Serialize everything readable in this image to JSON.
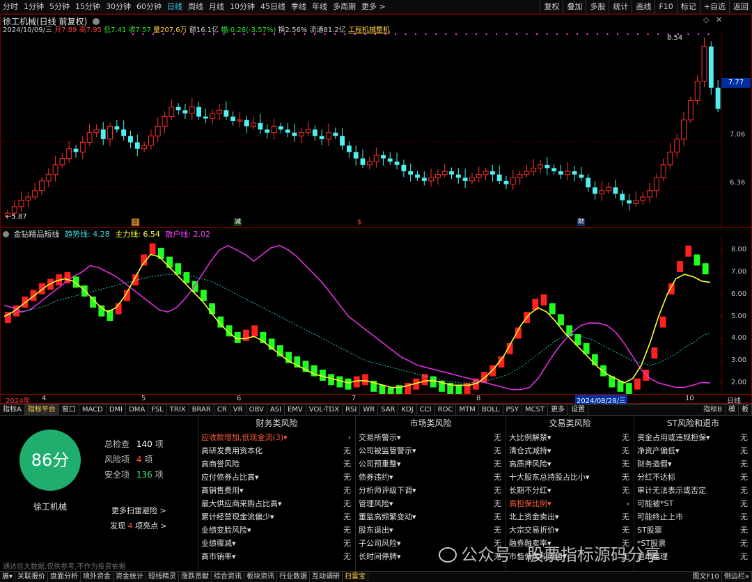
{
  "periods": [
    "分时",
    "1分钟",
    "5分钟",
    "15分钟",
    "30分钟",
    "60分钟",
    "日线",
    "周线",
    "月线",
    "10分钟",
    "45日线",
    "季线",
    "年线",
    "多周期",
    "更多 >"
  ],
  "active_period_index": 6,
  "right_tools": [
    "复权",
    "叠加",
    "多股",
    "统计",
    "画线",
    "F10",
    "标记",
    "+自选",
    "返回"
  ],
  "stock": {
    "title": "徐工机械(日线 前复权)",
    "info_date": "2024/10/09/三",
    "info_open": "开7.89",
    "info_high": "高7.95",
    "info_low": "低7.41",
    "info_close": "收7.57",
    "info_vol": "量207.6万",
    "info_amount": "额16.1亿",
    "info_change": "幅-0.28(-3.57%)",
    "info_turnover": "换2.56%",
    "info_float": "流通81.2亿",
    "info_industry": "工程机械整机",
    "price_high_label": "8.54",
    "price_low_label": "←5.87",
    "current_price": "7.77"
  },
  "main_yaxis": [
    "7.06",
    "6.36"
  ],
  "indicator": {
    "name": "金钻精品短线",
    "trend": "趋势线: 4.28",
    "main": "主力线: 6.54",
    "retail": "散户线: 2.02"
  },
  "ind_yaxis": [
    "8.00",
    "7.00",
    "6.00",
    "5.00",
    "4.00",
    "3.00",
    "2.00"
  ],
  "xaxis": {
    "year": "2024年",
    "m4": "4",
    "m5": "5",
    "m6": "6",
    "m7": "7",
    "m8": "8",
    "selected": "2024/08/28/三",
    "m10": "10",
    "daily": "日线"
  },
  "event_markers": {
    "m1": "回",
    "m2": "减",
    "m3": "$",
    "m4": "财"
  },
  "indicator_tabs": [
    "指标A",
    "指标平台",
    "窗口",
    "MACD",
    "DMI",
    "DMA",
    "FSL",
    "TRIX",
    "BRAR",
    "CR",
    "VR",
    "OBV",
    "ASI",
    "EMV",
    "VOL-TDX",
    "RSI",
    "WR",
    "SAR",
    "KDJ",
    "CCI",
    "ROC",
    "MTM",
    "BOLL",
    "PSY",
    "MCST",
    "更多",
    "设置"
  ],
  "indicator_tabs_right": [
    "指标B",
    "模",
    "板"
  ],
  "risk": {
    "score": "86分",
    "company": "徐工机械",
    "total_label": "总检查",
    "total_value": "140",
    "total_unit": "项",
    "risk_label": "风险项",
    "risk_value": "4",
    "risk_unit": "项",
    "safe_label": "安全项",
    "safe_value": "136",
    "safe_unit": "项",
    "more_link": "更多扫雷避险 >",
    "highlight_pre": "发现",
    "highlight_count": "4",
    "highlight_post": "项亮点 >",
    "disclaimer": "通达信大数据,仅供参考,不作为投资依据",
    "columns": [
      {
        "title": "财务类风险",
        "rows": [
          {
            "name": "应收款增加,低现金流(3)▾",
            "value": "›",
            "hi": true
          },
          {
            "name": "高研发费用资本化",
            "value": "无"
          },
          {
            "name": "高商誉风险",
            "value": "无"
          },
          {
            "name": "应付债券占比高▾",
            "value": "无"
          },
          {
            "name": "高销售费用▾",
            "value": "无"
          },
          {
            "name": "最大供应商采购占比高▾",
            "value": "无"
          },
          {
            "name": "累计经营现金流偏少▾",
            "value": "无"
          },
          {
            "name": "业绩变脸风险▾",
            "value": "无"
          },
          {
            "name": "业绩骤减▾",
            "value": "无"
          },
          {
            "name": "高市销率▾",
            "value": "无"
          }
        ]
      },
      {
        "title": "市场类风险",
        "rows": [
          {
            "name": "交易所警示▾",
            "value": "无"
          },
          {
            "name": "公司被监管警示▾",
            "value": "无"
          },
          {
            "name": "公司预重整▾",
            "value": "无"
          },
          {
            "name": "债券违约▾",
            "value": "无"
          },
          {
            "name": "分析师评级下调▾",
            "value": "无"
          },
          {
            "name": "管理风险▾",
            "value": "无"
          },
          {
            "name": "董监高频繁变动▾",
            "value": "无"
          },
          {
            "name": "股东退出▾",
            "value": "无"
          },
          {
            "name": "子公司风险▾",
            "value": "无"
          },
          {
            "name": "长时间停牌▾",
            "value": "无"
          }
        ]
      },
      {
        "title": "交易类风险",
        "rows": [
          {
            "name": "大比例解禁▾",
            "value": "无"
          },
          {
            "name": "清仓式减持▾",
            "value": "无"
          },
          {
            "name": "高质押风险▾",
            "value": "无"
          },
          {
            "name": "十大股东总持股占比小▾",
            "value": "无"
          },
          {
            "name": "长期不分红▾",
            "value": "无"
          },
          {
            "name": "高担保比例▾",
            "value": "›",
            "hi": true
          },
          {
            "name": "北上资金卖出▾",
            "value": "无"
          },
          {
            "name": "大宗交易折价▾",
            "value": "无"
          },
          {
            "name": "融券融卖率▾",
            "value": "无"
          },
          {
            "name": "市值偏离和流通▾",
            "value": "无"
          }
        ]
      },
      {
        "title": "ST风险和退市",
        "rows": [
          {
            "name": "资金占用或违规担保▾",
            "value": "无"
          },
          {
            "name": "净资产偏低▾",
            "value": "无"
          },
          {
            "name": "财务造假▾",
            "value": "无"
          },
          {
            "name": "分红不达标",
            "value": "无"
          },
          {
            "name": "审计无法表示或否定",
            "value": "无"
          },
          {
            "name": "可能被*ST",
            "value": "无"
          },
          {
            "name": "可能终止上市",
            "value": "无"
          },
          {
            "name": "ST股票",
            "value": "无"
          },
          {
            "name": "*ST股票",
            "value": "无"
          },
          {
            "name": "退市整理",
            "value": "无"
          }
        ]
      }
    ]
  },
  "watermark": "公众号 · 股票指标源码分享",
  "status_items": [
    "展▾",
    "关联报价",
    "盘面分析",
    "境外资金",
    "资金统计",
    "短线精灵",
    "涨跌贡献",
    "综合资讯",
    "板块资讯",
    "行业数据",
    "互动调研",
    "扫雷宝"
  ],
  "status_right": [
    "图文F10",
    "侧边栏»"
  ],
  "chart_data": {
    "type": "candlestick",
    "title": "徐工机械(日线 前复权)",
    "ylim_price": [
      5.8,
      8.7
    ],
    "y_ticks_price": [
      7.06,
      6.36
    ],
    "marked_high": 8.54,
    "marked_low": 5.87,
    "last_close": 7.57,
    "current_price": 7.77,
    "close_series": [
      5.95,
      6.05,
      6.15,
      6.2,
      6.3,
      6.45,
      6.55,
      6.7,
      6.8,
      6.95,
      6.9,
      7.05,
      7.2,
      7.25,
      7.1,
      7.3,
      7.25,
      7.15,
      7.05,
      6.95,
      7.0,
      7.15,
      7.3,
      7.45,
      7.6,
      7.55,
      7.5,
      7.6,
      7.45,
      7.42,
      7.5,
      7.55,
      7.45,
      7.38,
      7.4,
      7.3,
      7.35,
      7.25,
      7.2,
      7.3,
      7.25,
      7.2,
      7.15,
      7.2,
      7.25,
      7.15,
      7.1,
      7.2,
      7.15,
      7.0,
      6.9,
      6.8,
      6.7,
      6.75,
      6.85,
      6.8,
      6.75,
      6.7,
      6.6,
      6.55,
      6.5,
      6.45,
      6.5,
      6.55,
      6.6,
      6.55,
      6.5,
      6.45,
      6.5,
      6.55,
      6.6,
      6.55,
      6.45,
      6.4,
      6.5,
      6.55,
      6.6,
      6.65,
      6.7,
      6.65,
      6.6,
      6.55,
      6.6,
      6.55,
      6.5,
      6.35,
      6.25,
      6.3,
      6.35,
      6.25,
      6.15,
      6.1,
      6.15,
      6.2,
      6.3,
      6.5,
      6.7,
      6.9,
      7.1,
      7.4,
      7.7,
      8.0,
      8.54,
      7.9,
      7.57
    ],
    "indicator": {
      "name": "金钻精品短线",
      "ylim": [
        1.5,
        8.6
      ],
      "trend_last": 4.28,
      "main_last": 6.54,
      "retail_last": 2.02,
      "bar_series": [
        5.2,
        5.5,
        5.9,
        6.2,
        6.5,
        6.7,
        6.9,
        7.0,
        6.8,
        6.4,
        5.9,
        5.5,
        5.3,
        5.6,
        6.2,
        6.9,
        7.8,
        8.3,
        8.1,
        7.7,
        7.4,
        7.0,
        6.6,
        6.2,
        5.6,
        5.0,
        4.6,
        4.3,
        4.4,
        4.6,
        4.3,
        4.0,
        3.7,
        3.4,
        3.2,
        3.0,
        2.8,
        2.6,
        2.4,
        2.3,
        2.2,
        2.3,
        2.4,
        2.1,
        1.9,
        1.8,
        1.9,
        2.0,
        2.2,
        2.4,
        2.3,
        2.1,
        2.0,
        1.9,
        2.0,
        2.2,
        2.5,
        2.8,
        3.2,
        3.8,
        4.5,
        5.2,
        5.8,
        6.0,
        5.6,
        5.1,
        4.6,
        4.2,
        3.8,
        3.3,
        2.8,
        2.3,
        2.1,
        2.0,
        2.2,
        2.6,
        3.6,
        5.0,
        6.5,
        7.5,
        8.2,
        7.8,
        7.4
      ],
      "bar_up": [
        1,
        1,
        1,
        1,
        1,
        1,
        1,
        1,
        0,
        0,
        0,
        0,
        0,
        1,
        1,
        1,
        1,
        1,
        0,
        0,
        0,
        0,
        0,
        0,
        0,
        0,
        0,
        0,
        1,
        1,
        0,
        0,
        0,
        0,
        0,
        0,
        0,
        0,
        0,
        0,
        0,
        1,
        1,
        0,
        0,
        0,
        0,
        1,
        1,
        1,
        0,
        0,
        0,
        0,
        1,
        1,
        1,
        1,
        1,
        1,
        1,
        1,
        1,
        1,
        0,
        0,
        0,
        0,
        0,
        0,
        0,
        0,
        0,
        0,
        1,
        1,
        1,
        1,
        1,
        1,
        1,
        0,
        0
      ],
      "main_series": [
        5.0,
        5.2,
        5.5,
        5.8,
        6.1,
        6.4,
        6.6,
        6.7,
        6.6,
        6.3,
        5.9,
        5.5,
        5.2,
        5.4,
        5.9,
        6.6,
        7.3,
        7.8,
        7.7,
        7.3,
        6.9,
        6.5,
        6.1,
        5.7,
        5.2,
        4.7,
        4.3,
        4.0,
        4.0,
        4.1,
        3.9,
        3.6,
        3.3,
        3.0,
        2.8,
        2.6,
        2.4,
        2.3,
        2.2,
        2.1,
        2.0,
        2.1,
        2.1,
        2.0,
        1.9,
        1.8,
        1.8,
        1.9,
        2.0,
        2.1,
        2.1,
        2.0,
        1.9,
        1.9,
        1.9,
        2.0,
        2.3,
        2.7,
        3.2,
        3.9,
        4.6,
        5.1,
        5.4,
        5.2,
        4.8,
        4.3,
        3.9,
        3.5,
        3.1,
        2.7,
        2.4,
        2.2,
        2.0,
        2.2,
        2.8,
        3.8,
        5.0,
        6.0,
        6.7,
        6.9,
        6.8,
        6.6,
        6.54
      ],
      "trend_series": [
        5.0,
        5.1,
        5.2,
        5.3,
        5.4,
        5.5,
        5.7,
        5.8,
        5.9,
        6.0,
        6.1,
        6.2,
        6.3,
        6.4,
        6.5,
        6.6,
        6.7,
        6.8,
        6.85,
        6.9,
        6.9,
        6.85,
        6.8,
        6.7,
        6.6,
        6.4,
        6.2,
        6.0,
        5.8,
        5.6,
        5.4,
        5.2,
        5.0,
        4.8,
        4.6,
        4.4,
        4.2,
        4.0,
        3.8,
        3.6,
        3.4,
        3.2,
        3.0,
        2.9,
        2.8,
        2.7,
        2.6,
        2.5,
        2.4,
        2.3,
        2.2,
        2.1,
        2.05,
        2.0,
        2.0,
        2.05,
        2.1,
        2.2,
        2.3,
        2.5,
        2.7,
        3.0,
        3.3,
        3.6,
        3.9,
        4.1,
        4.2,
        4.1,
        4.0,
        3.8,
        3.6,
        3.4,
        3.2,
        3.0,
        2.9,
        2.8,
        2.9,
        3.1,
        3.3,
        3.6,
        3.8,
        4.1,
        4.28
      ],
      "retail_series": [
        5.5,
        5.4,
        5.2,
        5.3,
        5.6,
        5.9,
        6.2,
        6.5,
        6.8,
        7.0,
        7.3,
        7.2,
        7.0,
        6.8,
        6.5,
        6.2,
        5.9,
        5.6,
        5.3,
        5.2,
        5.4,
        5.8,
        6.3,
        6.9,
        7.5,
        8.0,
        8.2,
        8.0,
        7.8,
        7.5,
        7.8,
        8.1,
        8.2,
        8.0,
        7.7,
        7.3,
        6.9,
        6.5,
        6.0,
        5.5,
        5.0,
        4.7,
        4.4,
        4.1,
        3.8,
        3.5,
        3.2,
        3.0,
        2.8,
        2.7,
        2.6,
        2.5,
        2.4,
        2.3,
        2.2,
        2.1,
        2.0,
        1.9,
        1.8,
        1.7,
        1.7,
        1.8,
        2.2,
        2.8,
        3.4,
        3.9,
        4.3,
        4.6,
        4.7,
        4.7,
        4.6,
        4.3,
        3.8,
        3.2,
        2.6,
        2.2,
        2.0,
        1.9,
        1.8,
        1.8,
        1.9,
        2.02,
        2.0
      ]
    }
  }
}
